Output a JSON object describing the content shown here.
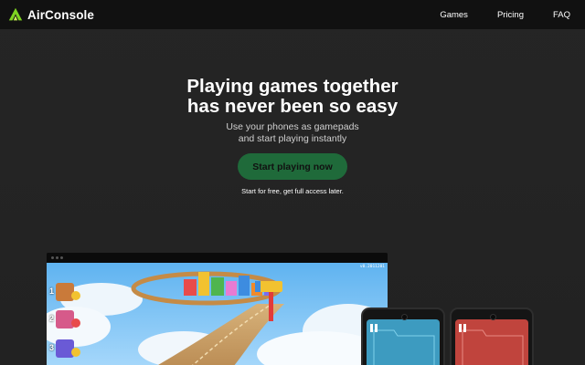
{
  "header": {
    "brand": "AirConsole",
    "nav": [
      {
        "label": "Games"
      },
      {
        "label": "Pricing"
      },
      {
        "label": "FAQ"
      }
    ]
  },
  "hero": {
    "title_line1": "Playing games together",
    "title_line2": "has never been so easy",
    "subtitle_line1": "Use your phones as gamepads",
    "subtitle_line2": "and start playing instantly",
    "cta_label": "Start playing now",
    "cta_note": "Start for free, get full access later."
  },
  "showcase": {
    "version": "v0.2011201",
    "ranks": [
      "1",
      "2",
      "3"
    ]
  },
  "colors": {
    "background": "#232323",
    "header": "#111111",
    "cta": "#1f6a3a",
    "logo_green": "#7ed321",
    "phone_blue": "#3d9bc0",
    "phone_red": "#c0443d"
  },
  "icons": [
    "airconsole-logo-icon",
    "pause-icon"
  ]
}
